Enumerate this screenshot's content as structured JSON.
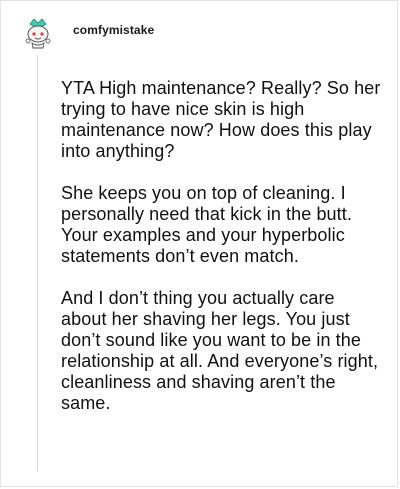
{
  "comment": {
    "author": "comfymistake",
    "avatar_icon": "snoo-avatar-icon",
    "paragraphs": [
      "YTA High maintenance? Really? So her trying to have nice skin is high maintenance now? How does this play into anything?",
      "She keeps you on top of cleaning. I personally need that kick in the butt. Your examples and your hyperbolic statements don’t even match.",
      "And I don’t thing you actually care about her shaving her legs. You just don’t sound like you want to be in the relationship at all. And everyone’s right, cleanliness and shaving aren’t the same."
    ]
  },
  "colors": {
    "avatar_accent": "#3ec9b3",
    "avatar_eye": "#e03c3c",
    "thread_line": "#d8d8d8",
    "text": "#111111"
  }
}
